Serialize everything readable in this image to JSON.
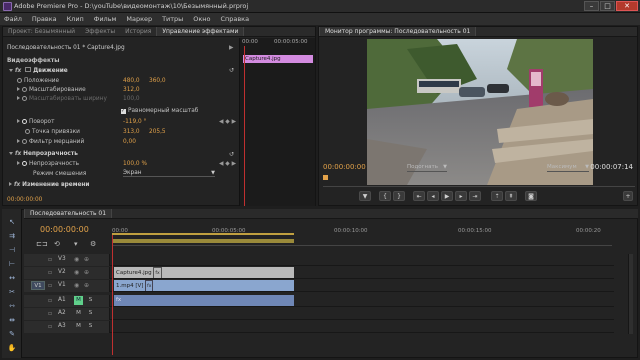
{
  "window": {
    "title": "Adobe Premiere Pro - D:\\youTube\\видеомонтаж\\10\\Безымянный.prproj",
    "min_glyph": "–",
    "max_glyph": "□",
    "close_glyph": "✕"
  },
  "menu": [
    "Файл",
    "Правка",
    "Клип",
    "Фильм",
    "Маркер",
    "Титры",
    "Окно",
    "Справка"
  ],
  "effects_panel": {
    "tabs": [
      "Проект: Безымянный",
      "Эффекты",
      "История",
      "Управление эффектами"
    ],
    "header_left": "Последовательность 01 * Capture4.jpg",
    "header_arrow": "▶",
    "ruler_start": "00:00",
    "ruler_end": "00:00:05:00",
    "clip_name": "Capture4.jpg",
    "section": "Видеоэффекты",
    "motion": "Движение",
    "rows": {
      "position": {
        "label": "Положение",
        "v1": "480,0",
        "v2": "360,0"
      },
      "scale": {
        "label": "Масштабирование",
        "v1": "312,0"
      },
      "scale_width": {
        "label": "Масштабировать ширину",
        "v1": "100,0"
      },
      "uniform": {
        "label": "Равномерный масштаб"
      },
      "rotation": {
        "label": "Поворот",
        "v1": "-119,0 °"
      },
      "anchor": {
        "label": "Точка привязки",
        "v1": "313,0",
        "v2": "205,5"
      },
      "flicker": {
        "label": "Фильтр мерцаний",
        "v1": "0,00"
      }
    },
    "opacity": "Непрозрачность",
    "opacity_row": {
      "label": "Непрозрачность",
      "v1": "100,0 %"
    },
    "blend": {
      "label": "Режим смешения",
      "value": "Экран"
    },
    "time_remap": "Изменение времени",
    "footer_time": "00:00:00:00"
  },
  "monitor": {
    "tab": "Монитор программы: Последовательность 01",
    "time_left": "00:00:00:00",
    "fit": "Подогнать",
    "quality": "Максимум",
    "time_right": "00:00:07:14"
  },
  "timeline": {
    "tab": "Последовательность 01",
    "time": "00:00:00:00",
    "ruler": [
      "00:00",
      "00:00:05:00",
      "00:00:10:00",
      "00:00:15:00",
      "00:00:20"
    ],
    "tracks": [
      {
        "name": "V3"
      },
      {
        "name": "V2",
        "clip": "Capture4.jpg"
      },
      {
        "name": "V1",
        "src": "V1",
        "clip": "1.mp4 [V]"
      },
      {
        "name": "A1",
        "src": "A1"
      },
      {
        "name": "A2"
      },
      {
        "name": "A3"
      }
    ],
    "m_label": "M",
    "s_label": "S"
  },
  "colors": {
    "accent_time": "#e2a24a",
    "clip_video": "#8aa6cf",
    "clip_image": "#b9b9b9",
    "clip_audio": "#6f87b6",
    "effect_clip": "#d38be0",
    "playhead": "#c03030"
  }
}
